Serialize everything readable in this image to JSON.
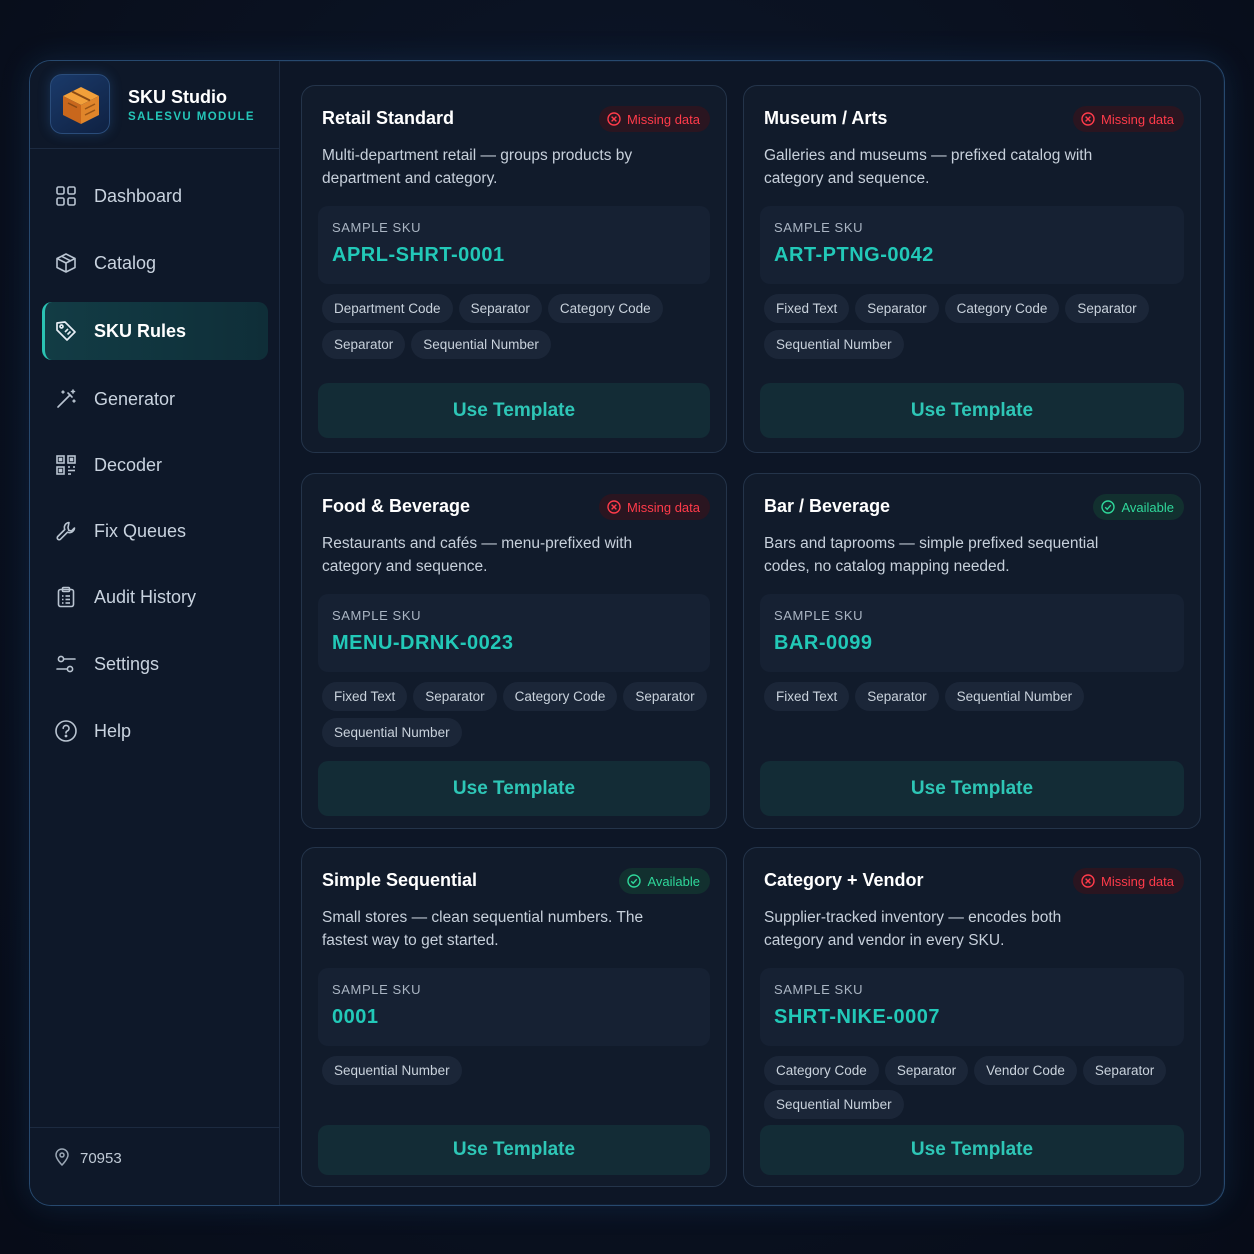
{
  "brand": {
    "title": "SKU Studio",
    "subtitle": "SALESVU MODULE"
  },
  "nav": [
    {
      "label": "Dashboard",
      "icon": "grid-icon"
    },
    {
      "label": "Catalog",
      "icon": "box-icon"
    },
    {
      "label": "SKU Rules",
      "icon": "tag-icon",
      "active": true
    },
    {
      "label": "Generator",
      "icon": "magic-wand-icon"
    },
    {
      "label": "Decoder",
      "icon": "qr-code-icon"
    },
    {
      "label": "Fix Queues",
      "icon": "wrench-icon"
    },
    {
      "label": "Audit History",
      "icon": "clipboard-icon"
    },
    {
      "label": "Settings",
      "icon": "sliders-icon"
    },
    {
      "label": "Help",
      "icon": "help-circle-icon"
    }
  ],
  "footer": {
    "location_code": "70953",
    "icon": "location-pin-icon"
  },
  "colors": {
    "accent": "#22c9b8",
    "missing": "#ff3b4a",
    "available": "#2fd79a",
    "background": "#0d1626"
  },
  "templates": [
    {
      "title": "Retail Standard",
      "status": "Missing data",
      "status_type": "missing",
      "description": "Multi-department retail — groups products by department and category.",
      "sample_label": "SAMPLE SKU",
      "sample_sku": "APRL-SHRT-0001",
      "segments": [
        "Department Code",
        "Separator",
        "Category Code",
        "Separator",
        "Sequential Number"
      ],
      "button": "Use Template"
    },
    {
      "title": "Museum / Arts",
      "status": "Missing data",
      "status_type": "missing",
      "description": "Galleries and museums — prefixed catalog with category and sequence.",
      "sample_label": "SAMPLE SKU",
      "sample_sku": "ART-PTNG-0042",
      "segments": [
        "Fixed Text",
        "Separator",
        "Category Code",
        "Separator",
        "Sequential Number"
      ],
      "button": "Use Template"
    },
    {
      "title": "Food & Beverage",
      "status": "Missing data",
      "status_type": "missing",
      "description": "Restaurants and cafés — menu-prefixed with category and sequence.",
      "sample_label": "SAMPLE SKU",
      "sample_sku": "MENU-DRNK-0023",
      "segments": [
        "Fixed Text",
        "Separator",
        "Category Code",
        "Separator",
        "Sequential Number"
      ],
      "button": "Use Template"
    },
    {
      "title": "Bar / Beverage",
      "status": "Available",
      "status_type": "ok",
      "description": "Bars and taprooms — simple prefixed sequential codes, no catalog mapping needed.",
      "sample_label": "SAMPLE SKU",
      "sample_sku": "BAR-0099",
      "segments": [
        "Fixed Text",
        "Separator",
        "Sequential Number"
      ],
      "button": "Use Template"
    },
    {
      "title": "Simple Sequential",
      "status": "Available",
      "status_type": "ok",
      "description": "Small stores — clean sequential numbers. The fastest way to get started.",
      "sample_label": "SAMPLE SKU",
      "sample_sku": "0001",
      "segments": [
        "Sequential Number"
      ],
      "button": "Use Template"
    },
    {
      "title": "Category + Vendor",
      "status": "Missing data",
      "status_type": "missing",
      "description": "Supplier-tracked inventory — encodes both category and vendor in every SKU.",
      "sample_label": "SAMPLE SKU",
      "sample_sku": "SHRT-NIKE-0007",
      "segments": [
        "Category Code",
        "Separator",
        "Vendor Code",
        "Separator",
        "Sequential Number"
      ],
      "button": "Use Template"
    }
  ]
}
